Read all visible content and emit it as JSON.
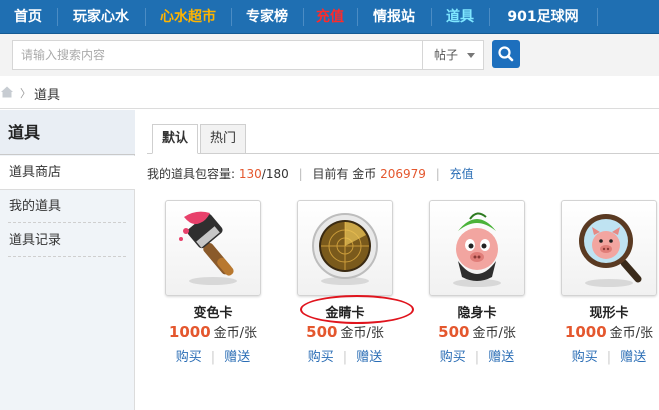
{
  "nav": {
    "items": [
      "首页",
      "玩家心水",
      "心水超市",
      "专家榜",
      "充值",
      "情报站",
      "道具",
      "901足球网"
    ]
  },
  "search": {
    "placeholder": "请输入搜索内容",
    "scope": "帖子"
  },
  "breadcrumb": {
    "current": "道具"
  },
  "sidebar": {
    "title": "道具",
    "items": [
      "道具商店",
      "我的道具",
      "道具记录"
    ]
  },
  "tabs": [
    "默认",
    "热门"
  ],
  "capacity": {
    "label": "我的道具包容量:",
    "used": "130",
    "total": "/180",
    "coins_label": "目前有 金币",
    "coins": "206979",
    "recharge": "充值"
  },
  "items": [
    {
      "name": "变色卡",
      "price": "1000",
      "unit": "金币/张",
      "buy": "购买",
      "gift": "赠送",
      "icon": "paint-brush-icon"
    },
    {
      "name": "金睛卡",
      "price": "500",
      "unit": "金币/张",
      "buy": "购买",
      "gift": "赠送",
      "icon": "radar-icon"
    },
    {
      "name": "隐身卡",
      "price": "500",
      "unit": "金币/张",
      "buy": "购买",
      "gift": "赠送",
      "icon": "pig-disguise-icon"
    },
    {
      "name": "现形卡",
      "price": "1000",
      "unit": "金币/张",
      "buy": "购买",
      "gift": "赠送",
      "icon": "magnifier-pig-icon"
    }
  ],
  "colors": {
    "nav_bg": "#1f6fb2",
    "accent_orange": "#ffb400",
    "highlight_red": "#e0141d",
    "price": "#e4572e",
    "link": "#2a6db5"
  }
}
